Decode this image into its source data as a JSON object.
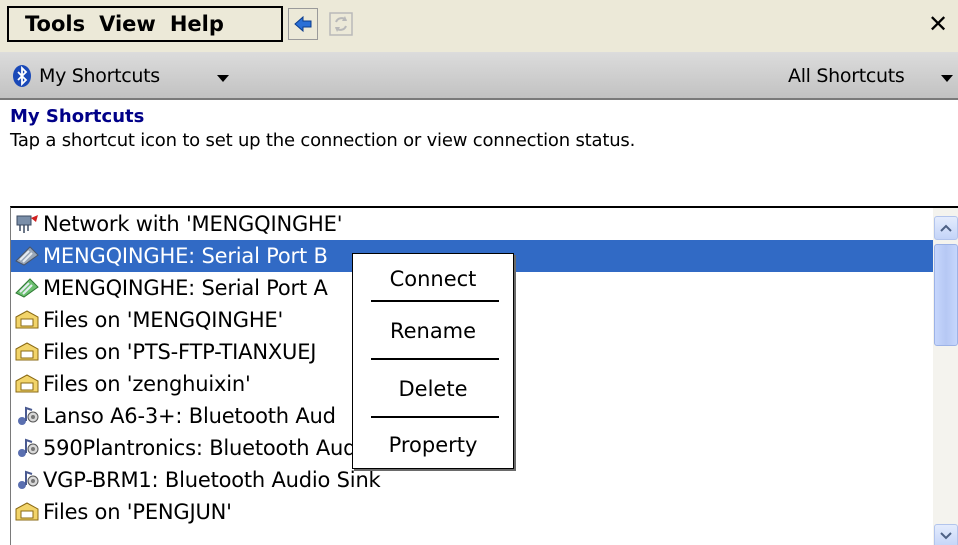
{
  "menubar": {
    "tools": "Tools",
    "view": "View",
    "help": "Help"
  },
  "navbar": {
    "left_label": "My Shortcuts",
    "right_label": "All Shortcuts"
  },
  "header": {
    "title": "My Shortcuts",
    "description": "Tap a shortcut icon to set up the connection or view connection status."
  },
  "list": {
    "items": [
      {
        "label": "Network with 'MENGQINGHE'",
        "icon": "network-icon",
        "selected": false
      },
      {
        "label": "MENGQINGHE: Serial Port B",
        "icon": "serial-port-icon",
        "selected": true
      },
      {
        "label": "MENGQINGHE: Serial Port A",
        "icon": "serial-port-icon",
        "selected": false
      },
      {
        "label": "Files on 'MENGQINGHE'",
        "icon": "folder-icon",
        "selected": false
      },
      {
        "label": "Files on 'PTS-FTP-TIANXUEJ",
        "icon": "folder-icon",
        "selected": false
      },
      {
        "label": "Files on 'zenghuixin'",
        "icon": "folder-icon",
        "selected": false
      },
      {
        "label": "Lanso A6-3+: Bluetooth Aud",
        "icon": "audio-icon",
        "selected": false
      },
      {
        "label": "590Plantronics: Bluetooth Audio Sink",
        "icon": "audio-icon",
        "selected": false
      },
      {
        "label": "VGP-BRM1: Bluetooth Audio Sink",
        "icon": "audio-icon",
        "selected": false
      },
      {
        "label": "Files on 'PENGJUN'",
        "icon": "folder-icon",
        "selected": false
      }
    ]
  },
  "context_menu": {
    "items": [
      "Connect",
      "Rename",
      "Delete",
      "Property"
    ]
  },
  "colors": {
    "selection": "#316ac5",
    "title": "#000088",
    "menubar_bg": "#ece9d8"
  }
}
